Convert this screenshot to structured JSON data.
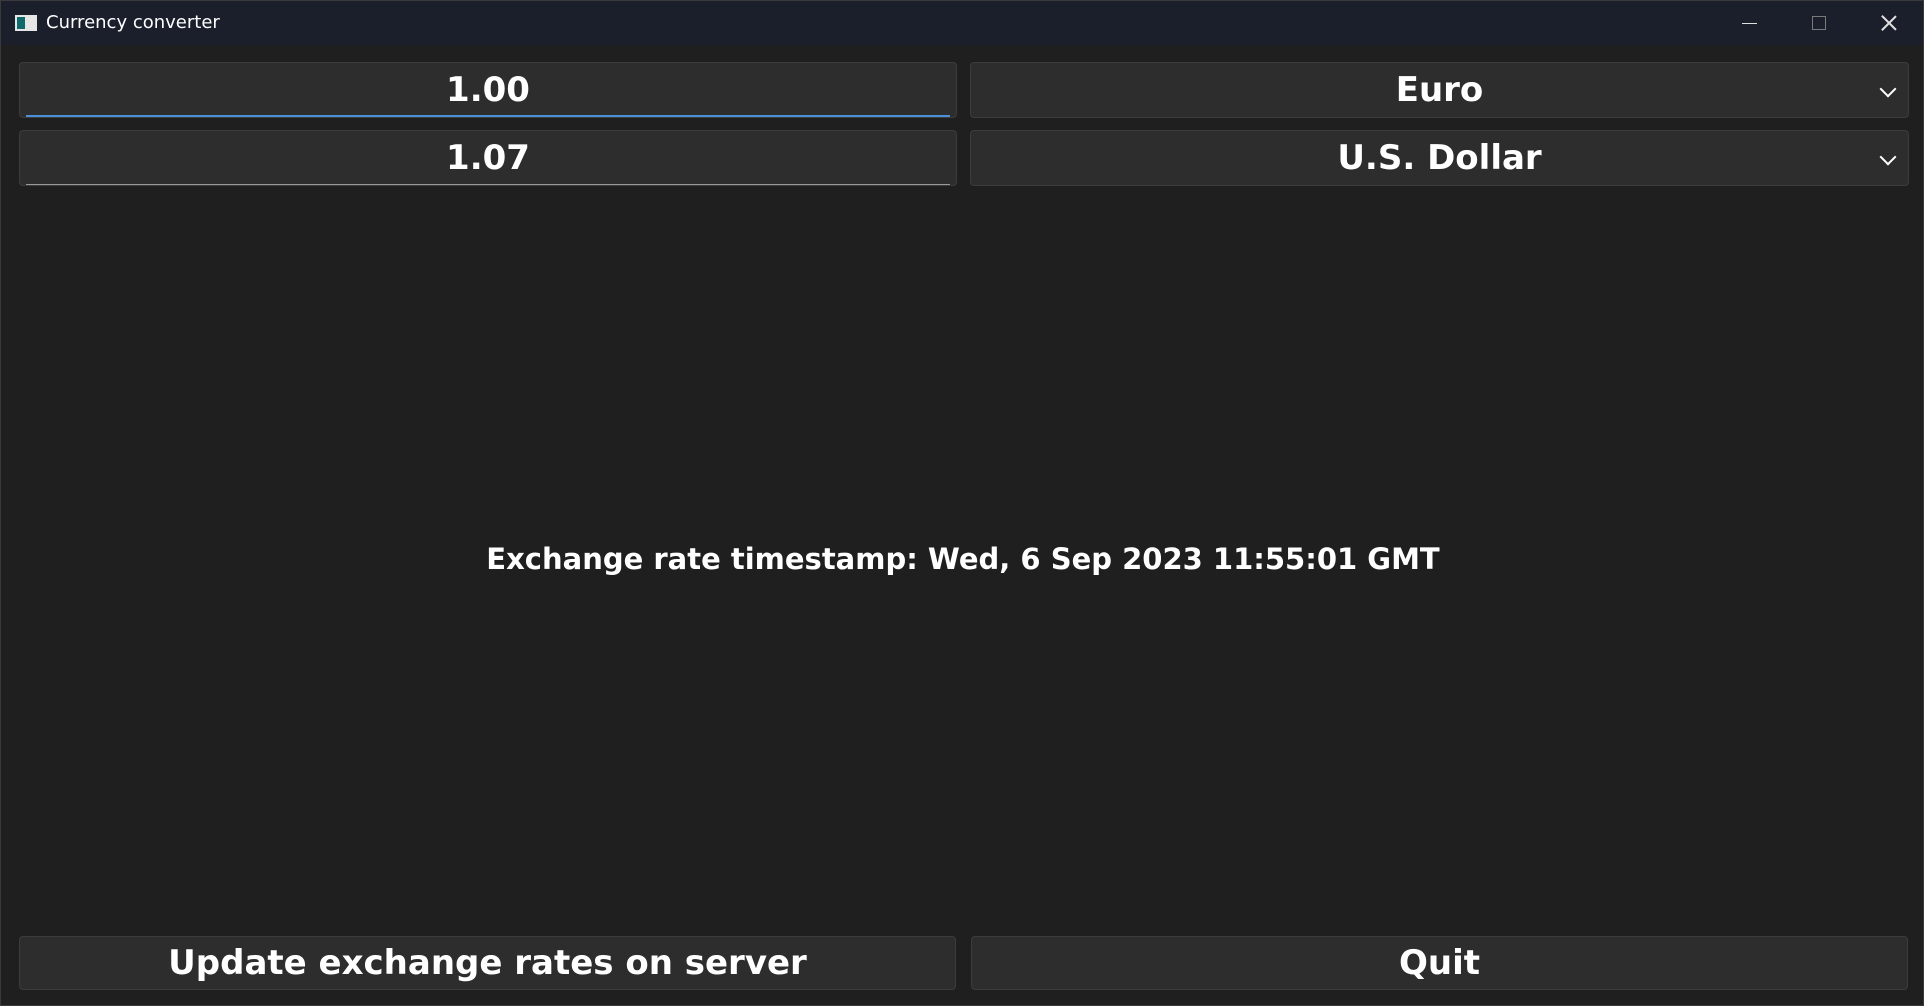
{
  "window": {
    "title": "Currency converter"
  },
  "converter": {
    "amount_from": "1.00",
    "amount_to": "1.07",
    "currency_from": "Euro",
    "currency_to": "U.S. Dollar"
  },
  "status": {
    "timestamp_text": "Exchange rate timestamp: Wed, 6 Sep 2023 11:55:01 GMT"
  },
  "actions": {
    "update_label": "Update exchange rates on server",
    "quit_label": "Quit"
  },
  "colors": {
    "background": "#1f1f1f",
    "titlebar": "#1a1f2b",
    "control": "#2d2d2d",
    "focus_accent": "#4a90d9"
  }
}
